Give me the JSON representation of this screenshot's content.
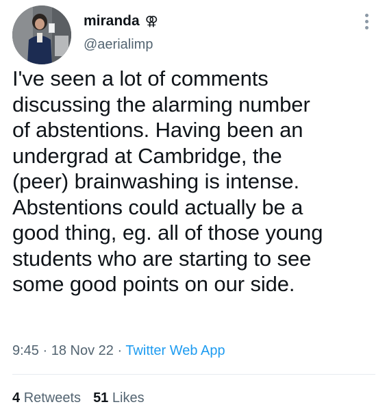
{
  "author": {
    "display_name": "miranda",
    "name_symbol": "⚢",
    "handle": "@aerialimp"
  },
  "more_icon": "more-vertical-icon",
  "tweet": {
    "lines": [
      "I've seen a lot of comments",
      "discussing the alarming number",
      "of abstentions. Having been an",
      "undergrad at Cambridge, the",
      "(peer) brainwashing is intense.",
      "Abstentions could actually be a",
      "good thing, eg. all of those young",
      "students who are starting to see",
      "some good points on our side."
    ]
  },
  "meta": {
    "time": "9:45",
    "separator": " · ",
    "date": "18 Nov 22",
    "app": "Twitter Web App"
  },
  "stats": {
    "retweets_count": "4",
    "retweets_label": "Retweets",
    "likes_count": "51",
    "likes_label": "Likes"
  },
  "colors": {
    "text": "#0f1419",
    "secondary": "#536471",
    "link": "#1d9bf0",
    "divider": "#e6ebef"
  }
}
